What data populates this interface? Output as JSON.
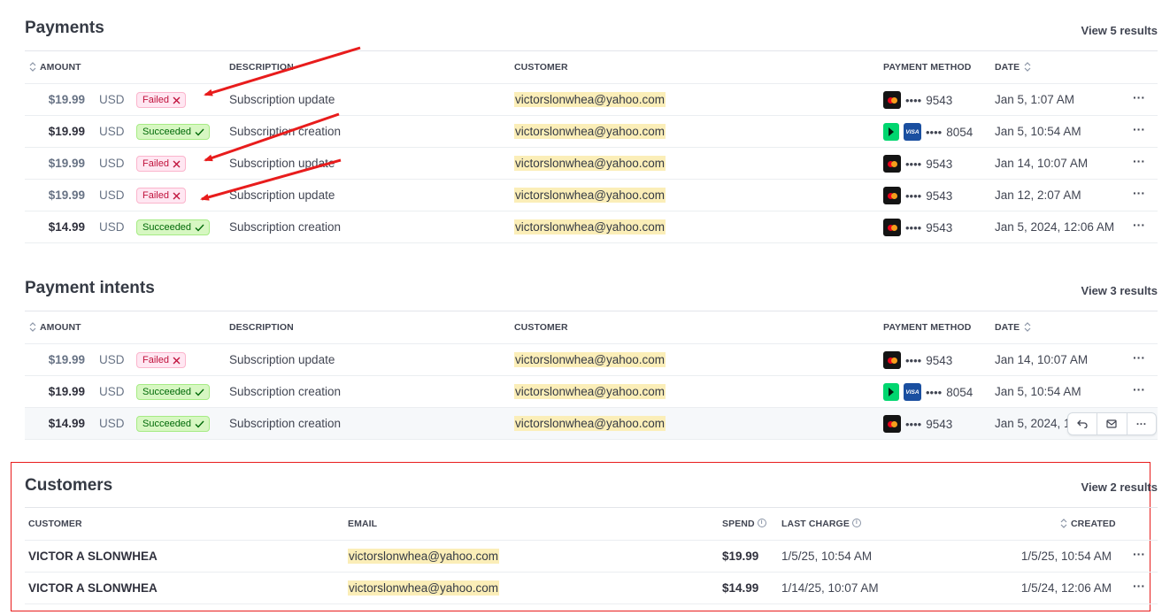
{
  "payments": {
    "title": "Payments",
    "view_results": "View 5 results",
    "headers": {
      "amount": "AMOUNT",
      "description": "DESCRIPTION",
      "customer": "CUSTOMER",
      "payment_method": "PAYMENT METHOD",
      "date": "DATE"
    },
    "rows": [
      {
        "amount": "$19.99",
        "currency": "USD",
        "status": "Failed",
        "description": "Subscription update",
        "customer": "victorslonwhea@yahoo.com",
        "pm_dots": "••••",
        "last4": "9543",
        "date": "Jan 5, 1:07 AM",
        "more": "···"
      },
      {
        "amount": "$19.99",
        "currency": "USD",
        "status": "Succeeded",
        "description": "Subscription creation",
        "customer": "victorslonwhea@yahoo.com",
        "pm_dots": "••••",
        "last4": "8054",
        "date": "Jan 5, 10:54 AM",
        "more": "···"
      },
      {
        "amount": "$19.99",
        "currency": "USD",
        "status": "Failed",
        "description": "Subscription update",
        "customer": "victorslonwhea@yahoo.com",
        "pm_dots": "••••",
        "last4": "9543",
        "date": "Jan 14, 10:07 AM",
        "more": "···"
      },
      {
        "amount": "$19.99",
        "currency": "USD",
        "status": "Failed",
        "description": "Subscription update",
        "customer": "victorslonwhea@yahoo.com",
        "pm_dots": "••••",
        "last4": "9543",
        "date": "Jan 12, 2:07 AM",
        "more": "···"
      },
      {
        "amount": "$14.99",
        "currency": "USD",
        "status": "Succeeded",
        "description": "Subscription creation",
        "customer": "victorslonwhea@yahoo.com",
        "pm_dots": "••••",
        "last4": "9543",
        "date": "Jan 5, 2024, 12:06 AM",
        "more": "···"
      }
    ]
  },
  "intents": {
    "title": "Payment intents",
    "view_results": "View 3 results",
    "headers": {
      "amount": "AMOUNT",
      "description": "DESCRIPTION",
      "customer": "CUSTOMER",
      "payment_method": "PAYMENT METHOD",
      "date": "DATE"
    },
    "rows": [
      {
        "amount": "$19.99",
        "currency": "USD",
        "status": "Failed",
        "description": "Subscription update",
        "customer": "victorslonwhea@yahoo.com",
        "pm_dots": "••••",
        "last4": "9543",
        "date": "Jan 14, 10:07 AM",
        "more": "···"
      },
      {
        "amount": "$19.99",
        "currency": "USD",
        "status": "Succeeded",
        "description": "Subscription creation",
        "customer": "victorslonwhea@yahoo.com",
        "pm_dots": "••••",
        "last4": "8054",
        "date": "Jan 5, 10:54 AM",
        "more": "···"
      },
      {
        "amount": "$14.99",
        "currency": "USD",
        "status": "Succeeded",
        "description": "Subscription creation",
        "customer": "victorslonwhea@yahoo.com",
        "pm_dots": "••••",
        "last4": "9543",
        "date": "Jan 5, 2024, 1",
        "more": "···"
      }
    ]
  },
  "customers": {
    "title": "Customers",
    "view_results": "View 2 results",
    "headers": {
      "customer": "CUSTOMER",
      "email": "EMAIL",
      "spend": "SPEND",
      "last_charge": "LAST CHARGE",
      "created": "CREATED"
    },
    "rows": [
      {
        "name": "VICTOR A SLONWHEA",
        "email": "victorslonwhea@yahoo.com",
        "spend": "$19.99",
        "last_charge": "1/5/25, 10:54 AM",
        "created": "1/5/25, 10:54 AM",
        "more": "···"
      },
      {
        "name": "VICTOR A SLONWHEA",
        "email": "victorslonwhea@yahoo.com",
        "spend": "$14.99",
        "last_charge": "1/14/25, 10:07 AM",
        "created": "1/5/24, 12:06 AM",
        "more": "···"
      }
    ]
  },
  "colors": {
    "annotation_red": "#e81c1c",
    "email_highlight": "#fbeeb8",
    "failed": "#c0123c",
    "succeeded": "#006908"
  },
  "icons": {
    "failed": "x-icon",
    "succeeded": "check-icon",
    "card": "mastercard-icon",
    "link": "link-chevron-icon",
    "visa": "visa-icon",
    "sort": "sort-icon",
    "info": "info-icon",
    "refund": "refund-icon",
    "email": "email-icon",
    "more": "more-icon"
  },
  "visa_label": "VISA",
  "info_glyph": "i"
}
